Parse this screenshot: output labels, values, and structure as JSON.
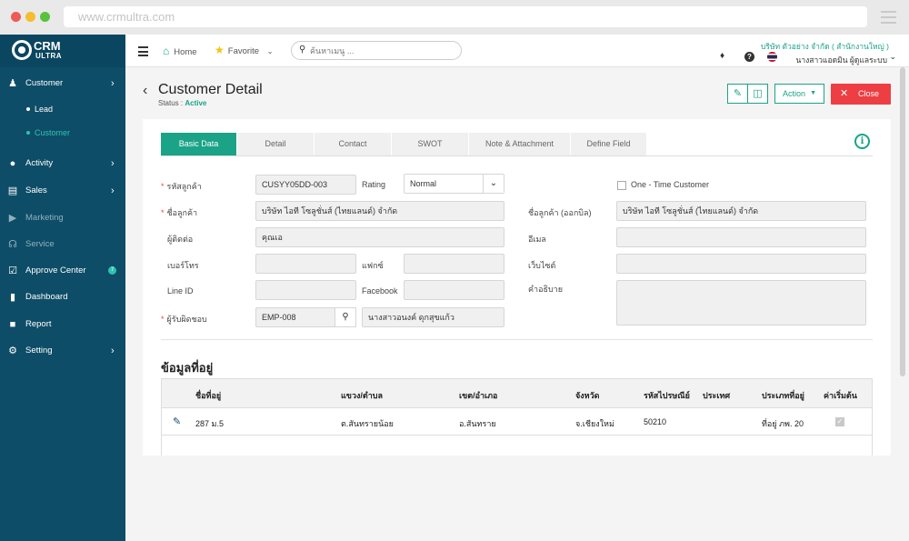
{
  "browser": {
    "url": "www.crmultra.com"
  },
  "logo": {
    "line1": "CRM",
    "line2": "ULTRA"
  },
  "sidebar": {
    "items": [
      {
        "label": "Customer",
        "icon": "users-icon"
      },
      {
        "label": "Activity",
        "icon": "chat-icon"
      },
      {
        "label": "Sales",
        "icon": "money-icon"
      },
      {
        "label": "Marketing",
        "icon": "megaphone-icon"
      },
      {
        "label": "Service",
        "icon": "headset-icon"
      },
      {
        "label": "Approve Center",
        "icon": "check-square-icon",
        "badge": "7"
      },
      {
        "label": "Dashboard",
        "icon": "bar-chart-icon"
      },
      {
        "label": "Report",
        "icon": "file-icon"
      },
      {
        "label": "Setting",
        "icon": "gear-icon"
      }
    ],
    "sub_items": [
      {
        "label": "Lead"
      },
      {
        "label": "Customer"
      }
    ]
  },
  "topbar": {
    "home": "Home",
    "favorite": "Favorite",
    "search_placeholder": "ค้นหาเมนู ...",
    "company": "บริษัท ตัวอย่าง จำกัด ( สำนักงานใหญ่ )",
    "user": "นางสาวแอดมิน ผู้ดูแลระบบ"
  },
  "header": {
    "title": "Customer Detail",
    "status_label": "Status : ",
    "status_value": "Active",
    "action_label": "Action",
    "close_label": "Close"
  },
  "tabs": [
    "Basic Data",
    "Detail",
    "Contact",
    "SWOT",
    "Note & Attachment",
    "Define Field"
  ],
  "form": {
    "customer_code_label": "รหัสลูกค้า",
    "customer_code": "CUSYY05DD-003",
    "rating_label": "Rating",
    "rating": "Normal",
    "one_time_label": "One - Time Customer",
    "customer_name_label": "ชื่อลูกค้า",
    "customer_name": "บริษัท ไอที โซลูชั่นส์ (ไทยแลนด์) จำกัด",
    "billing_name_label": "ชื่อลูกค้า (ออกบิล)",
    "billing_name": "บริษัท ไอที โซลูชั่นส์ (ไทยแลนด์) จำกัด",
    "contact_label": "ผู้ติดต่อ",
    "contact": "คุณเอ",
    "email_label": "อีเมล",
    "email": "",
    "phone_label": "เบอร์โทร",
    "phone": "",
    "fax_label": "แฟกซ์",
    "fax": "",
    "website_label": "เว็บไซต์",
    "website": "",
    "line_label": "Line ID",
    "line": "",
    "facebook_label": "Facebook",
    "facebook": "",
    "description_label": "คำอธิบาย",
    "description": "",
    "owner_label": "ผู้รับผิดชอบ",
    "owner_code": "EMP-008",
    "owner_name": "นางสาวอนงค์ ดุกสุขแก้ว"
  },
  "address": {
    "title": "ข้อมูลที่อยู่",
    "columns": [
      "ชื่อที่อยู่",
      "แขวง/ตำบล",
      "เขต/อำเภอ",
      "จังหวัด",
      "รหัสไปรษณีย์",
      "ประเทศ",
      "ประเภทที่อยู่",
      "ค่าเริ่มต้น"
    ],
    "rows": [
      {
        "name": "287 ม.5",
        "subdistrict": "ต.สันทรายน้อย",
        "district": "อ.สันทราย",
        "province": "จ.เชียงใหม่",
        "postcode": "50210",
        "country": "",
        "type": "ที่อยู่ ภพ. 20",
        "default": true
      }
    ]
  },
  "colors": {
    "sidebar": "#0e4d67",
    "accent": "#1aa387",
    "danger": "#ed3e44"
  }
}
